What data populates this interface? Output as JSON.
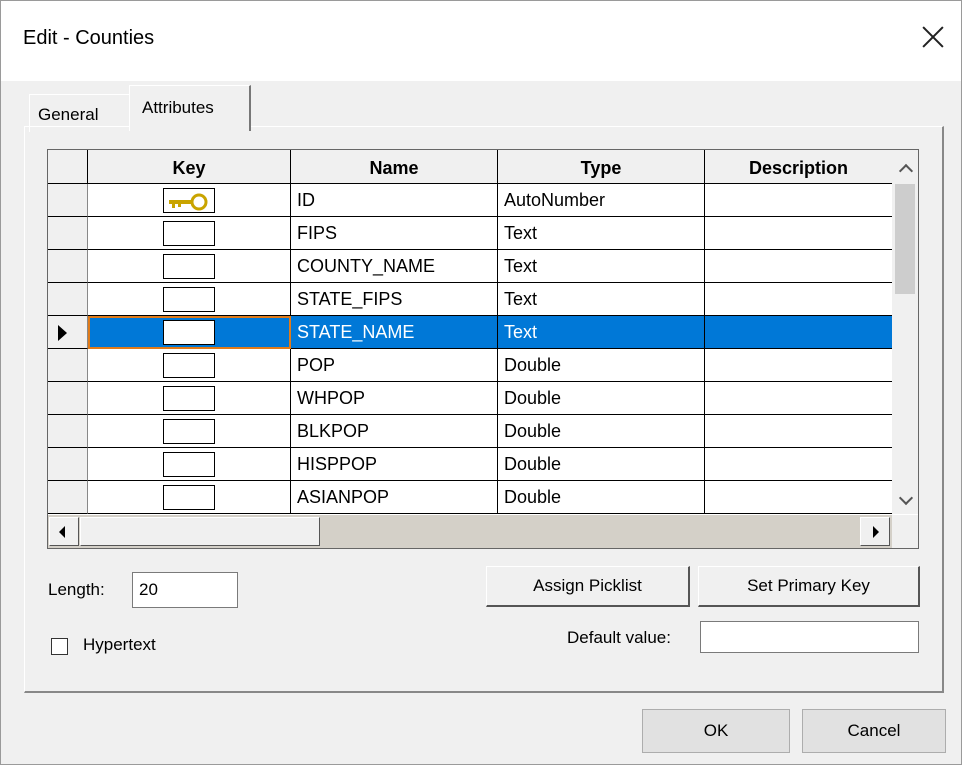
{
  "window": {
    "title": "Edit - Counties"
  },
  "tabs": [
    {
      "label": "General"
    },
    {
      "label": "Attributes"
    }
  ],
  "grid": {
    "columns": [
      "Key",
      "Name",
      "Type",
      "Description"
    ],
    "rows": [
      {
        "key": true,
        "name": "ID",
        "type": "AutoNumber",
        "description": ""
      },
      {
        "key": false,
        "name": "FIPS",
        "type": "Text",
        "description": ""
      },
      {
        "key": false,
        "name": "COUNTY_NAME",
        "type": "Text",
        "description": ""
      },
      {
        "key": false,
        "name": "STATE_FIPS",
        "type": "Text",
        "description": ""
      },
      {
        "key": false,
        "name": "STATE_NAME",
        "type": "Text",
        "description": "",
        "selected": true
      },
      {
        "key": false,
        "name": "POP",
        "type": "Double",
        "description": ""
      },
      {
        "key": false,
        "name": "WHPOP",
        "type": "Double",
        "description": ""
      },
      {
        "key": false,
        "name": "BLKPOP",
        "type": "Double",
        "description": ""
      },
      {
        "key": false,
        "name": "HISPPOP",
        "type": "Double",
        "description": ""
      },
      {
        "key": false,
        "name": "ASIANPOP",
        "type": "Double",
        "description": ""
      }
    ]
  },
  "length": {
    "label": "Length:",
    "value": "20"
  },
  "hypertext": {
    "label": "Hypertext",
    "checked": false
  },
  "buttons": {
    "assign_picklist": "Assign Picklist",
    "set_primary_key": "Set Primary Key",
    "ok": "OK",
    "cancel": "Cancel"
  },
  "default_value": {
    "label": "Default value:",
    "value": ""
  },
  "colors": {
    "selection": "#0078d7",
    "focus_outline": "#e07b1a",
    "key_icon": "#c9a400"
  },
  "icons": {
    "key": "key-icon",
    "row_pointer": "row-pointer-icon"
  }
}
